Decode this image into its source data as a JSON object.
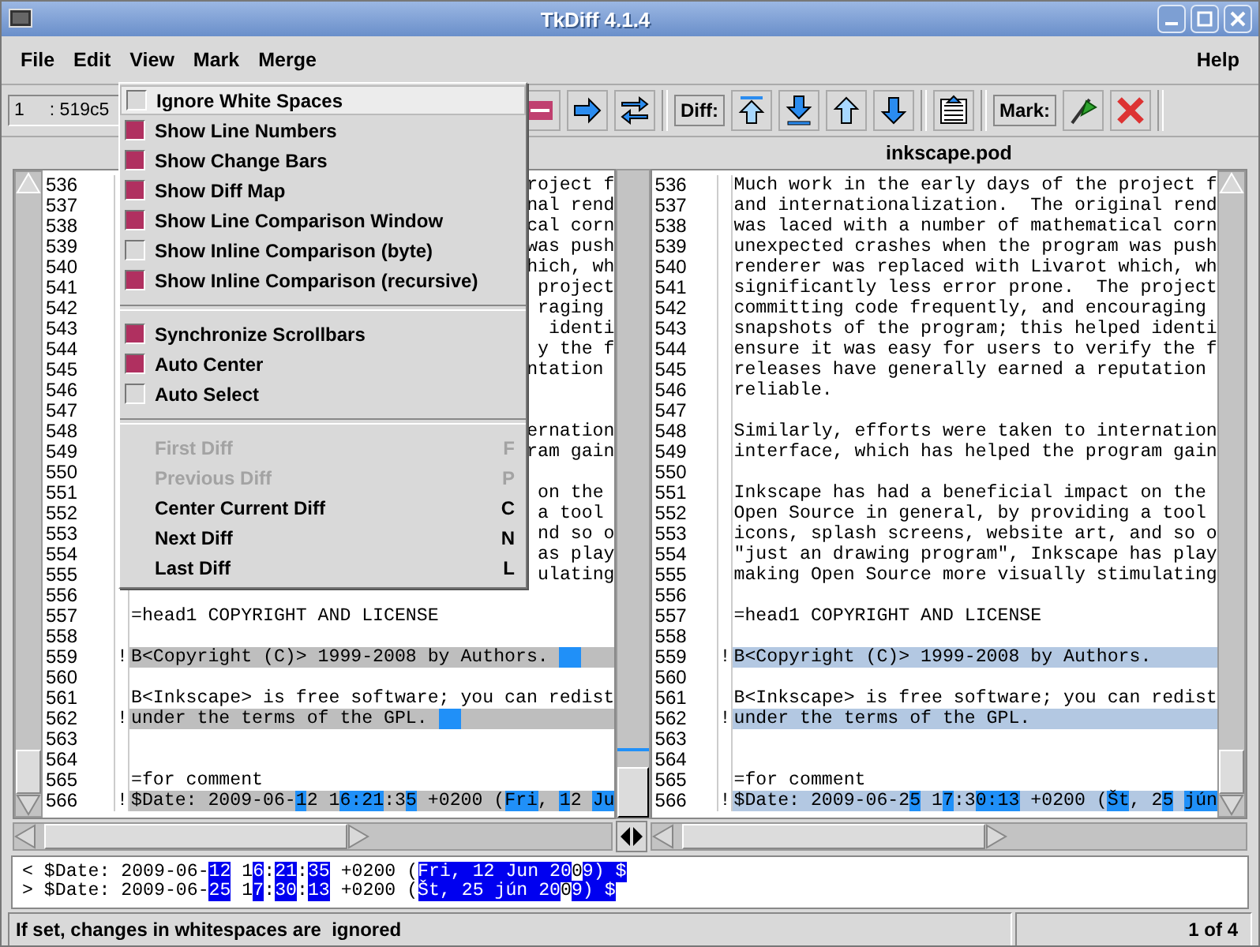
{
  "window": {
    "title": "TkDiff 4.1.4"
  },
  "menubar": [
    {
      "label": "File"
    },
    {
      "label": "Edit"
    },
    {
      "label": "View"
    },
    {
      "label": "Mark"
    },
    {
      "label": "Merge"
    },
    {
      "label": "Help"
    }
  ],
  "toolbar": {
    "line_field": {
      "line": "1",
      "value": ": 519c5"
    },
    "diff_label": "Diff:",
    "mark_label": "Mark:"
  },
  "right_file": {
    "name": "inkscape.pod"
  },
  "left_pane": {
    "lines": [
      {
        "number": "536",
        "kind": "tail",
        "text": "roject f"
      },
      {
        "number": "537",
        "kind": "tail",
        "text": "nal rend"
      },
      {
        "number": "538",
        "kind": "tail",
        "text": "cal corn"
      },
      {
        "number": "539",
        "kind": "tail",
        "text": "was push"
      },
      {
        "number": "540",
        "kind": "tail",
        "text": "hich, wh"
      },
      {
        "number": "541",
        "kind": "tail",
        "text": "project"
      },
      {
        "number": "542",
        "kind": "tail",
        "text": "raging "
      },
      {
        "number": "543",
        "kind": "tail",
        "text": "identi"
      },
      {
        "number": "544",
        "kind": "tail",
        "text": "y the f"
      },
      {
        "number": "545",
        "kind": "tail",
        "text": "ntation "
      },
      {
        "number": "546",
        "kind": "text"
      },
      {
        "number": "547",
        "kind": "text"
      },
      {
        "number": "548",
        "kind": "tail",
        "text": "ernation"
      },
      {
        "number": "549",
        "kind": "tail",
        "text": "ram gain"
      },
      {
        "number": "550",
        "kind": "text"
      },
      {
        "number": "551",
        "kind": "tail",
        "text": "on the "
      },
      {
        "number": "552",
        "kind": "tail",
        "text": "a tool "
      },
      {
        "number": "553",
        "kind": "tail",
        "text": "nd so o"
      },
      {
        "number": "554",
        "kind": "tail",
        "text": "as play"
      },
      {
        "number": "555",
        "kind": "tail",
        "text": "ulating"
      },
      {
        "number": "556",
        "kind": "text"
      },
      {
        "number": "557",
        "kind": "text",
        "text": "=head1 COPYRIGHT AND LICENSE"
      },
      {
        "number": "558",
        "kind": "text"
      },
      {
        "number": "559",
        "kind": "diff",
        "marker": "!",
        "trailing_mark": true,
        "segments": [
          {
            "text": "B<Copyright (C)> 1999-2008 by Authors.",
            "changed": false
          }
        ]
      },
      {
        "number": "560",
        "kind": "text"
      },
      {
        "number": "561",
        "kind": "text",
        "text": "B<Inkscape> is free software; you can redist"
      },
      {
        "number": "562",
        "kind": "diff",
        "marker": "!",
        "trailing_mark": true,
        "segments": [
          {
            "text": "under the terms of the GPL.",
            "changed": false
          }
        ]
      },
      {
        "number": "563",
        "kind": "text"
      },
      {
        "number": "564",
        "kind": "text"
      },
      {
        "number": "565",
        "kind": "text",
        "text": "=for comment"
      },
      {
        "number": "566",
        "kind": "diff",
        "marker": "!",
        "trailing_mark": false,
        "segments": [
          {
            "text": "$Date: 2009-06-",
            "changed": false
          },
          {
            "text": "1",
            "changed": true
          },
          {
            "text": "2 1",
            "changed": false
          },
          {
            "text": "6:21",
            "changed": true
          },
          {
            "text": ":3",
            "changed": false
          },
          {
            "text": "5",
            "changed": true
          },
          {
            "text": " +0200 (",
            "changed": false
          },
          {
            "text": "Fri",
            "changed": true
          },
          {
            "text": ", ",
            "changed": false
          },
          {
            "text": "1",
            "changed": true
          },
          {
            "text": "2 ",
            "changed": false
          },
          {
            "text": "Ju",
            "changed": true
          }
        ]
      }
    ]
  },
  "right_pane": {
    "lines": [
      {
        "number": "536",
        "kind": "text",
        "text": "Much work in the early days of the project f"
      },
      {
        "number": "537",
        "kind": "text",
        "text": "and internationalization.  The original rend"
      },
      {
        "number": "538",
        "kind": "text",
        "text": "was laced with a number of mathematical corn"
      },
      {
        "number": "539",
        "kind": "text",
        "text": "unexpected crashes when the program was push"
      },
      {
        "number": "540",
        "kind": "text",
        "text": "renderer was replaced with Livarot which, wh"
      },
      {
        "number": "541",
        "kind": "text",
        "text": "significantly less error prone.  The project"
      },
      {
        "number": "542",
        "kind": "text",
        "text": "committing code frequently, and encouraging"
      },
      {
        "number": "543",
        "kind": "text",
        "text": "snapshots of the program; this helped identi"
      },
      {
        "number": "544",
        "kind": "text",
        "text": "ensure it was easy for users to verify the f"
      },
      {
        "number": "545",
        "kind": "text",
        "text": "releases have generally earned a reputation"
      },
      {
        "number": "546",
        "kind": "text",
        "text": "reliable."
      },
      {
        "number": "547",
        "kind": "text"
      },
      {
        "number": "548",
        "kind": "text",
        "text": "Similarly, efforts were taken to internation"
      },
      {
        "number": "549",
        "kind": "text",
        "text": "interface, which has helped the program gain"
      },
      {
        "number": "550",
        "kind": "text"
      },
      {
        "number": "551",
        "kind": "text",
        "text": "Inkscape has had a beneficial impact on the"
      },
      {
        "number": "552",
        "kind": "text",
        "text": "Open Source in general, by providing a tool"
      },
      {
        "number": "553",
        "kind": "text",
        "text": "icons, splash screens, website art, and so o"
      },
      {
        "number": "554",
        "kind": "text",
        "text": "\"just an drawing program\", Inkscape has play"
      },
      {
        "number": "555",
        "kind": "text",
        "text": "making Open Source more visually stimulating"
      },
      {
        "number": "556",
        "kind": "text"
      },
      {
        "number": "557",
        "kind": "text",
        "text": "=head1 COPYRIGHT AND LICENSE"
      },
      {
        "number": "558",
        "kind": "text"
      },
      {
        "number": "559",
        "kind": "diff",
        "marker": "!",
        "trailing_mark": false,
        "segments": [
          {
            "text": "B<Copyright (C)> 1999-2008 by Authors.",
            "changed": false
          }
        ]
      },
      {
        "number": "560",
        "kind": "text"
      },
      {
        "number": "561",
        "kind": "text",
        "text": "B<Inkscape> is free software; you can redist"
      },
      {
        "number": "562",
        "kind": "diff",
        "marker": "!",
        "trailing_mark": false,
        "segments": [
          {
            "text": "under the terms of the GPL.",
            "changed": false
          }
        ]
      },
      {
        "number": "563",
        "kind": "text"
      },
      {
        "number": "564",
        "kind": "text"
      },
      {
        "number": "565",
        "kind": "text",
        "text": "=for comment"
      },
      {
        "number": "566",
        "kind": "diff",
        "marker": "!",
        "trailing_mark": false,
        "segments": [
          {
            "text": "$Date: 2009-06-2",
            "changed": false
          },
          {
            "text": "5",
            "changed": true
          },
          {
            "text": " 1",
            "changed": false
          },
          {
            "text": "7",
            "changed": true
          },
          {
            "text": ":3",
            "changed": false
          },
          {
            "text": "0:13",
            "changed": true
          },
          {
            "text": " +0200 (",
            "changed": false
          },
          {
            "text": "Št",
            "changed": true
          },
          {
            "text": ", 2",
            "changed": false
          },
          {
            "text": "5",
            "changed": true
          },
          {
            "text": "jún",
            "changed": true,
            "space_before": true
          }
        ]
      }
    ]
  },
  "compare": [
    {
      "segments": [
        {
          "text": "< $Date: 2009-06-",
          "changed": false
        },
        {
          "text": "12",
          "changed": true
        },
        {
          "text": " 1",
          "changed": false
        },
        {
          "text": "6",
          "changed": true
        },
        {
          "text": ":",
          "changed": false
        },
        {
          "text": "21",
          "changed": true
        },
        {
          "text": ":",
          "changed": false
        },
        {
          "text": "35",
          "changed": true
        },
        {
          "text": " +0200 (",
          "changed": false
        },
        {
          "text": "Fri, 12 Jun 20",
          "changed": true
        },
        {
          "text": "0",
          "changed": false
        },
        {
          "text": "9) $",
          "changed": true
        }
      ]
    },
    {
      "segments": [
        {
          "text": "> $Date: 2009-06-",
          "changed": false
        },
        {
          "text": "25",
          "changed": true
        },
        {
          "text": " 1",
          "changed": false
        },
        {
          "text": "7",
          "changed": true
        },
        {
          "text": ":",
          "changed": false
        },
        {
          "text": "30",
          "changed": true
        },
        {
          "text": ":",
          "changed": false
        },
        {
          "text": "13",
          "changed": true
        },
        {
          "text": " +0200 (",
          "changed": false
        },
        {
          "text": "Št, 25 jún 20",
          "changed": true
        },
        {
          "text": "0",
          "changed": false
        },
        {
          "text": "9) $",
          "changed": true
        }
      ]
    }
  ],
  "status_bar": {
    "message": "If set, changes in whitespaces are  ignored",
    "position": "1 of 4"
  },
  "view_menu": {
    "items": [
      {
        "kind": "check",
        "label": "Ignore White Spaces",
        "checked": false,
        "selected": true
      },
      {
        "kind": "check",
        "label": "Show Line Numbers",
        "checked": true,
        "selected": false
      },
      {
        "kind": "check",
        "label": "Show Change Bars",
        "checked": true,
        "selected": false
      },
      {
        "kind": "check",
        "label": "Show Diff Map",
        "checked": true,
        "selected": false
      },
      {
        "kind": "check",
        "label": "Show Line Comparison Window",
        "checked": true,
        "selected": false
      },
      {
        "kind": "check",
        "label": "Show Inline Comparison (byte)",
        "checked": false,
        "selected": false
      },
      {
        "kind": "check",
        "label": "Show Inline Comparison (recursive)",
        "checked": true,
        "selected": false
      },
      {
        "kind": "separator"
      },
      {
        "kind": "check",
        "label": "Synchronize Scrollbars",
        "checked": true,
        "selected": false
      },
      {
        "kind": "check",
        "label": "Auto Center",
        "checked": true,
        "selected": false
      },
      {
        "kind": "check",
        "label": "Auto Select",
        "checked": false,
        "selected": false
      },
      {
        "kind": "separator"
      },
      {
        "kind": "command",
        "label": "First Diff",
        "shortcut": "F",
        "disabled": true,
        "selected": false
      },
      {
        "kind": "command",
        "label": "Previous Diff",
        "shortcut": "P",
        "disabled": true,
        "selected": false
      },
      {
        "kind": "command",
        "label": "Center Current Diff",
        "shortcut": "C",
        "disabled": false,
        "selected": false
      },
      {
        "kind": "command",
        "label": "Next Diff",
        "shortcut": "N",
        "disabled": false,
        "selected": false
      },
      {
        "kind": "command",
        "label": "Last Diff",
        "shortcut": "L",
        "disabled": false,
        "selected": false
      }
    ]
  }
}
